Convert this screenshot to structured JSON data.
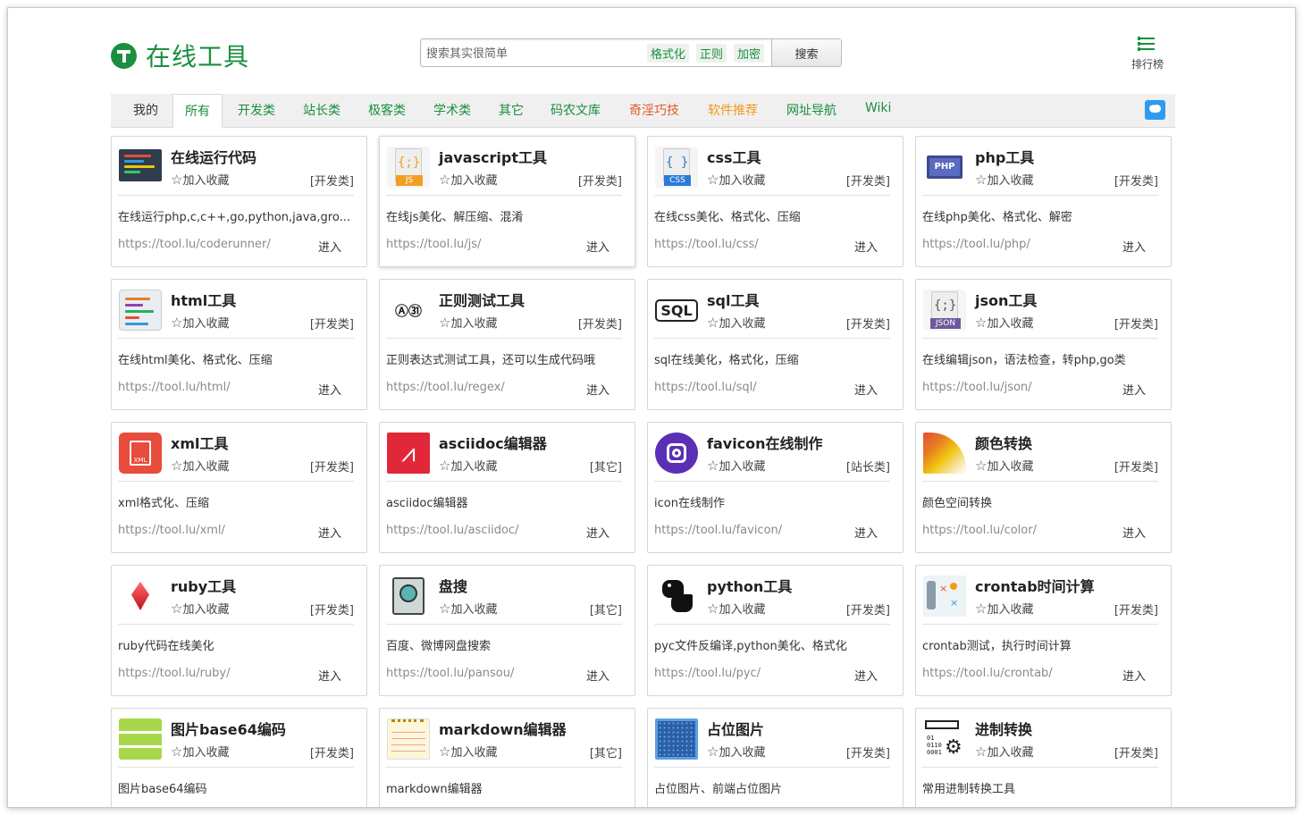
{
  "header": {
    "logo_text": "在线工具",
    "search_placeholder": "搜索其实很简单",
    "search_tags": [
      "格式化",
      "正则",
      "加密"
    ],
    "search_button": "搜索",
    "rank_label": "排行榜"
  },
  "nav": {
    "tabs": [
      {
        "label": "我的",
        "color": "#333333"
      },
      {
        "label": "所有",
        "color": "#1a8f3f"
      },
      {
        "label": "开发类",
        "color": "#1a8f3f"
      },
      {
        "label": "站长类",
        "color": "#1a8f3f"
      },
      {
        "label": "极客类",
        "color": "#1a8f3f"
      },
      {
        "label": "学术类",
        "color": "#1a8f3f"
      },
      {
        "label": "其它",
        "color": "#1a8f3f"
      },
      {
        "label": "码农文库",
        "color": "#1a8f3f"
      },
      {
        "label": "奇淫巧技",
        "color": "#e05a2b"
      },
      {
        "label": "软件推荐",
        "color": "#f09a1a"
      },
      {
        "label": "网址导航",
        "color": "#1a8f3f"
      },
      {
        "label": "Wiki",
        "color": "#1a8f3f"
      }
    ]
  },
  "fav_label": "加入收藏",
  "enter_label": "进入",
  "cards": [
    {
      "title": "在线运行代码",
      "category": "[开发类]",
      "desc": "在线运行php,c,c++,go,python,java,gro...",
      "url": "https://tool.lu/coderunner/",
      "icon": "code-screen-icon"
    },
    {
      "title": "javascript工具",
      "category": "[开发类]",
      "desc": "在线js美化、解压缩、混淆",
      "url": "https://tool.lu/js/",
      "icon": "js-file-icon"
    },
    {
      "title": "css工具",
      "category": "[开发类]",
      "desc": "在线css美化、格式化、压缩",
      "url": "https://tool.lu/css/",
      "icon": "css-file-icon"
    },
    {
      "title": "php工具",
      "category": "[开发类]",
      "desc": "在线php美化、格式化、解密",
      "url": "https://tool.lu/php/",
      "icon": "php-laptop-icon"
    },
    {
      "title": "html工具",
      "category": "[开发类]",
      "desc": "在线html美化、格式化、压缩",
      "url": "https://tool.lu/html/",
      "icon": "html-code-icon"
    },
    {
      "title": "正则测试工具",
      "category": "[开发类]",
      "desc": "正则表达式测试工具，还可以生成代码哦",
      "url": "https://tool.lu/regex/",
      "icon": "regex-icon"
    },
    {
      "title": "sql工具",
      "category": "[开发类]",
      "desc": "sql在线美化，格式化，压缩",
      "url": "https://tool.lu/sql/",
      "icon": "sql-icon"
    },
    {
      "title": "json工具",
      "category": "[开发类]",
      "desc": "在线编辑json，语法检查，转php,go类",
      "url": "https://tool.lu/json/",
      "icon": "json-file-icon"
    },
    {
      "title": "xml工具",
      "category": "[开发类]",
      "desc": "xml格式化、压缩",
      "url": "https://tool.lu/xml/",
      "icon": "xml-file-icon"
    },
    {
      "title": "asciidoc编辑器",
      "category": "[其它]",
      "desc": "asciidoc编辑器",
      "url": "https://tool.lu/asciidoc/",
      "icon": "asciidoc-icon"
    },
    {
      "title": "favicon在线制作",
      "category": "[站长类]",
      "desc": "icon在线制作",
      "url": "https://tool.lu/favicon/",
      "icon": "favicon-camera-icon"
    },
    {
      "title": "颜色转换",
      "category": "[开发类]",
      "desc": "颜色空间转换",
      "url": "https://tool.lu/color/",
      "icon": "color-palette-icon"
    },
    {
      "title": "ruby工具",
      "category": "[开发类]",
      "desc": "ruby代码在线美化",
      "url": "https://tool.lu/ruby/",
      "icon": "ruby-gem-icon"
    },
    {
      "title": "盘搜",
      "category": "[其它]",
      "desc": "百度、微博网盘搜索",
      "url": "https://tool.lu/pansou/",
      "icon": "disk-search-icon"
    },
    {
      "title": "python工具",
      "category": "[开发类]",
      "desc": "pyc文件反编译,python美化、格式化",
      "url": "https://tool.lu/pyc/",
      "icon": "python-logo-icon"
    },
    {
      "title": "crontab时间计算",
      "category": "[开发类]",
      "desc": "crontab测试，执行时间计算",
      "url": "https://tool.lu/crontab/",
      "icon": "crontab-chart-icon"
    },
    {
      "title": "图片base64编码",
      "category": "[开发类]",
      "desc": "图片base64编码",
      "url": "",
      "icon": "base64-server-icon"
    },
    {
      "title": "markdown编辑器",
      "category": "[其它]",
      "desc": "markdown编辑器",
      "url": "",
      "icon": "markdown-notepad-icon"
    },
    {
      "title": "占位图片",
      "category": "[开发类]",
      "desc": "占位图片、前端占位图片",
      "url": "",
      "icon": "placeholder-image-icon"
    },
    {
      "title": "进制转换",
      "category": "[开发类]",
      "desc": "常用进制转换工具",
      "url": "",
      "icon": "binary-gear-icon"
    }
  ]
}
